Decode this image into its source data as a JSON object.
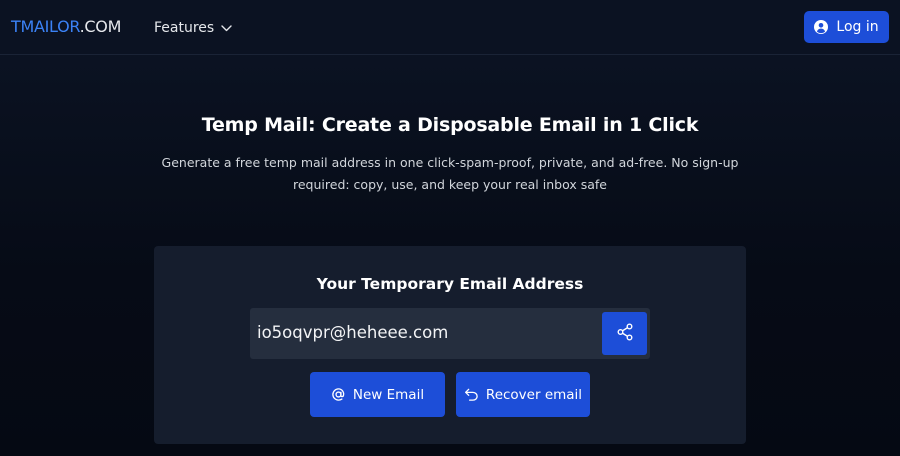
{
  "header": {
    "brand_part1": "TMAILOR",
    "brand_part2": ".COM",
    "features_label": "Features",
    "login_label": "Log in"
  },
  "hero": {
    "title": "Temp Mail: Create a Disposable Email in 1 Click",
    "subtitle": "Generate a free temp mail address in one click-spam-proof, private, and ad-free. No sign-up required: copy, use, and keep your real inbox safe"
  },
  "card": {
    "title": "Your Temporary Email Address",
    "email": "io5oqvpr@heheee.com",
    "new_email_label": "New Email",
    "recover_email_label": "Recover email"
  },
  "icons": {
    "features_chevron": "chevron-down-icon",
    "login": "user-circle-icon",
    "share": "share-icon",
    "new_email": "at-sign-icon",
    "recover_email": "undo-arrow-icon"
  },
  "colors": {
    "accent": "#1d4ed8",
    "brand_blue": "#3b82f6",
    "card_bg": "#151d2d",
    "email_bg": "#252e3e"
  }
}
